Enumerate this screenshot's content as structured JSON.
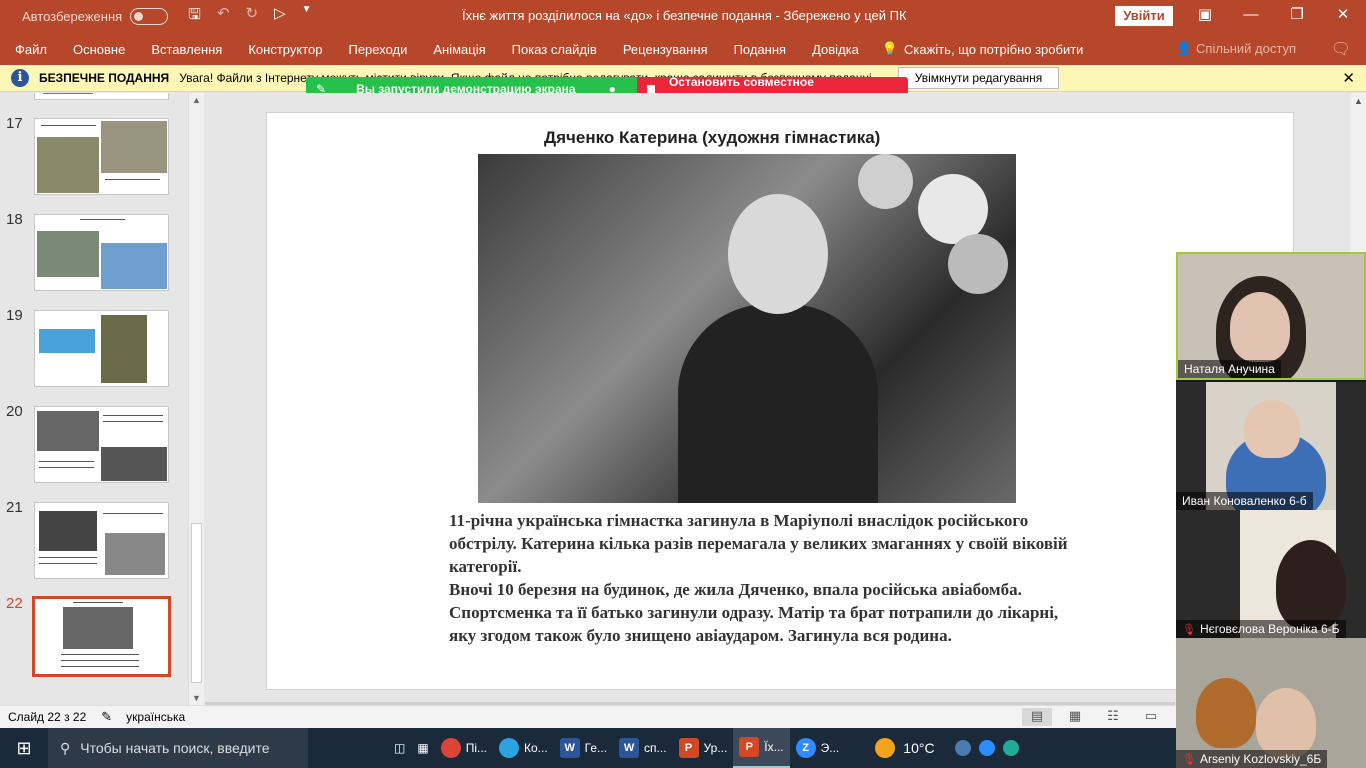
{
  "titlebar": {
    "autosave_label": "Автозбереження",
    "doc_title": "Їхнє життя розділилося на «до» і   безпечне подання  -  Збережено у цей ПК",
    "signin_label": "Увійти"
  },
  "ribbon": {
    "tabs": [
      "Файл",
      "Основне",
      "Вставлення",
      "Конструктор",
      "Переходи",
      "Анімація",
      "Показ слайдів",
      "Рецензування",
      "Подання",
      "Довідка"
    ],
    "tell_me": "Скажіть, що потрібно зробити",
    "share": "Спільний доступ"
  },
  "message_bar": {
    "title": "БЕЗПЕЧНЕ ПОДАННЯ",
    "text": "Увага! Файли з Інтернету можуть містити віруси. Якщо файл не потрібно редагувати, краще залишити в безпечному поданні.",
    "enable_button": "Увімкнути редагування"
  },
  "screen_share": {
    "status": "Вы запустили демонстрацию экрана",
    "stop": "Остановить совместное использование"
  },
  "thumbnails": [
    {
      "number": "17"
    },
    {
      "number": "18"
    },
    {
      "number": "19"
    },
    {
      "number": "20"
    },
    {
      "number": "21"
    },
    {
      "number": "22"
    }
  ],
  "slide": {
    "title": "Дяченко Катерина (художня гімнастика)",
    "paragraph1": "11-річна українська гімнастка загинула в Маріуполі внаслідок російського обстрілу. Катерина кілька разів перемагала у великих змаганнях у своїй віковій категорії.",
    "paragraph2": "Вночі 10 березня на будинок, де жила Дяченко, впала російська авіабомба. Спортсменка та її батько загинули одразу. Матір та брат потрапили до лікарні, яку згодом також було знищено авіаударом. Загинула вся родина."
  },
  "status": {
    "slide_counter": "Слайд 22 з 22",
    "language": "українська"
  },
  "taskbar": {
    "search_placeholder": "Чтобы начать поиск, введите",
    "apps": [
      {
        "label": "Пі...",
        "icon": "chrome-icon",
        "color": "#db4437"
      },
      {
        "label": "Ко...",
        "icon": "telegram-icon",
        "color": "#2aa3df"
      },
      {
        "label": "Ге...",
        "icon": "word-icon",
        "color": "#2b579a"
      },
      {
        "label": "сп...",
        "icon": "word-icon",
        "color": "#2b579a"
      },
      {
        "label": "Ур...",
        "icon": "powerpoint-icon",
        "color": "#d24726"
      },
      {
        "label": "Їх...",
        "icon": "powerpoint-icon",
        "color": "#d24726"
      },
      {
        "label": "Э...",
        "icon": "zoom-icon",
        "color": "#2d8cff"
      }
    ],
    "temperature": "10°C"
  },
  "participants": [
    {
      "name": "Наталя Анучина",
      "muted": false,
      "active": true
    },
    {
      "name": "Иван Коноваленко 6-б",
      "muted": false,
      "active": false
    },
    {
      "name": "Нєговєлова Вероніка 6-Б",
      "muted": true,
      "active": false
    },
    {
      "name": "Arseniy Kozlovskiy_6Б",
      "muted": true,
      "active": false
    }
  ]
}
